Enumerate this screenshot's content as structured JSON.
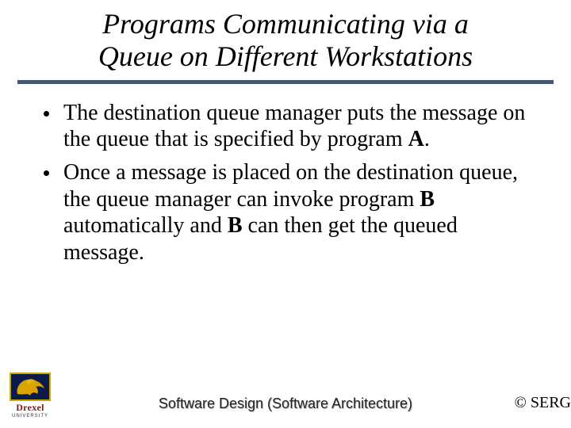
{
  "title_line1": "Programs Communicating via a",
  "title_line2": "Queue on Different Workstations",
  "bullets": [
    {
      "pre": "The destination queue manager puts the message on the queue that is specified by program ",
      "bold1": "A",
      "post": "."
    },
    {
      "pre": "Once a message is placed on the destination queue, the queue manager can invoke program ",
      "bold1": "B",
      "mid": " automatically and ",
      "bold2": "B",
      "post": " can then get the queued message."
    }
  ],
  "logo": {
    "name": "Drexel",
    "sub": "UNIVERSITY"
  },
  "footer_center": "Software Design (Software Architecture)",
  "footer_right": "© SERG"
}
